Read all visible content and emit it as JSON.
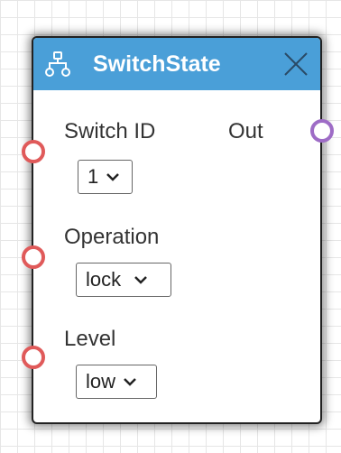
{
  "node": {
    "title": "SwitchState",
    "icon": "hierarchy-icon",
    "close_icon": "close-icon",
    "header_color": "#4a9fd8",
    "input_port_color": "#e05a5a",
    "output_port_color": "#9e6cc6",
    "inputs": [
      {
        "label": "Switch ID",
        "value": "1"
      },
      {
        "label": "Operation",
        "value": "lock"
      },
      {
        "label": "Level",
        "value": "low"
      }
    ],
    "outputs": [
      {
        "label": "Out"
      }
    ]
  }
}
